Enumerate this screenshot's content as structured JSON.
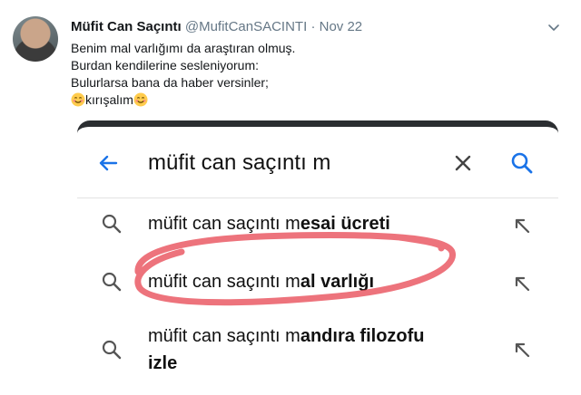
{
  "tweet": {
    "author_name": "Müfit Can Saçıntı",
    "handle": "@MufitCanSACINTI",
    "separator": "·",
    "date": "Nov 22",
    "lines": [
      "Benim mal varlığımı da araştıran olmuş.",
      "Burdan kendilerine sesleniyorum:",
      "Bulurlarsa bana da haber versinler;"
    ],
    "last_line_text": "kırışalım",
    "emoji": "smiling-face-emoji"
  },
  "screenshot": {
    "query": "müfit can saçıntı m",
    "suggestions": [
      {
        "prefix": "müfit can saçıntı m",
        "bold": "esai ücreti",
        "line2": ""
      },
      {
        "prefix": "müfit can saçıntı m",
        "bold": "al varlığı",
        "line2": ""
      },
      {
        "prefix": "müfit can saçıntı m",
        "bold": "andıra filozofu",
        "line2": "izle"
      }
    ],
    "highlight_color": "#e8505b"
  }
}
